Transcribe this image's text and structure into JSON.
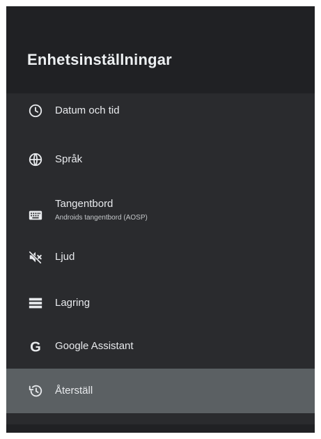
{
  "header": {
    "title": "Enhetsinställningar"
  },
  "menu": {
    "items": [
      {
        "label": "Datum och tid",
        "icon": "clock-icon"
      },
      {
        "label": "Språk",
        "icon": "globe-icon"
      },
      {
        "label": "Tangentbord",
        "sublabel": "Androids tangentbord (AOSP)",
        "icon": "keyboard-icon"
      },
      {
        "label": "Ljud",
        "icon": "sound-off-icon"
      },
      {
        "label": "Lagring",
        "icon": "storage-icon"
      },
      {
        "label": "Google Assistant",
        "icon": "google-icon"
      },
      {
        "label": "Återställ",
        "icon": "restore-icon",
        "selected": true
      }
    ]
  },
  "colors": {
    "background": "#202124",
    "list_background": "#2a2b2e",
    "selected_background": "#5b6063",
    "text": "#e8eaed",
    "subtext": "#c4c7ca"
  }
}
